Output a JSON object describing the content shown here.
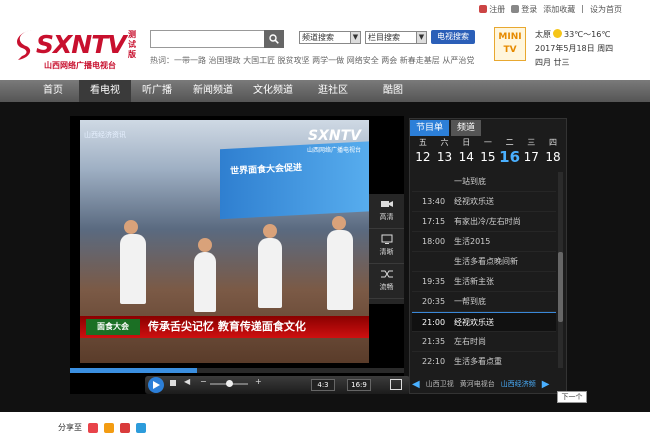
{
  "toplinks": {
    "register": "注册",
    "login": "登录",
    "favorite": "添加收藏",
    "homepage": "设为首页"
  },
  "logo": {
    "name": "SXNTV",
    "sub": "山西网络广播电视台",
    "beta": "测试版"
  },
  "search": {
    "placeholder": "",
    "hot_label": "热词：",
    "hot": "一带一路  治国理政  大国工匠  脱贫攻坚  两学一做  网络安全  两会  新春走基层  从严治党"
  },
  "selects": {
    "channel": "频道搜索",
    "column": "栏目搜索",
    "tv_search": "电视搜索"
  },
  "minitv": {
    "line1": "MINI",
    "line2": "TV"
  },
  "weather": {
    "city": "太原",
    "temp": "33℃～16℃",
    "date": "2017年5月18日",
    "weekday": "周四",
    "lunar": "四月 廿三"
  },
  "nav": [
    "首页",
    "看电视",
    "听广播",
    "新闻频道",
    "文化频道",
    "逛社区",
    "酷图"
  ],
  "nav_active": 1,
  "video": {
    "corner": "山西经济资讯",
    "logo": "SXNTV",
    "logo_sub": "山西网络广播电视台",
    "banner": "世界面食大会促进",
    "badge": "面食大会",
    "caption": "传承舌尖记忆  教育传递面食文化"
  },
  "side": [
    {
      "label": "高清",
      "icon": "camera-icon"
    },
    {
      "label": "清晰",
      "icon": "screen-icon"
    },
    {
      "label": "流畅",
      "icon": "shuffle-icon"
    }
  ],
  "controls": {
    "ratio_a": "4:3",
    "ratio_b": "16:9",
    "progress": 0.38,
    "volume": 0.5
  },
  "epg": {
    "tabs": [
      "节目单",
      "频道"
    ],
    "days": [
      {
        "w": "五",
        "d": "12"
      },
      {
        "w": "六",
        "d": "13"
      },
      {
        "w": "日",
        "d": "14"
      },
      {
        "w": "一",
        "d": "15"
      },
      {
        "w": "二",
        "d": "16"
      },
      {
        "w": "三",
        "d": "17"
      },
      {
        "w": "四",
        "d": "18"
      }
    ],
    "day_active": 4,
    "programs": [
      {
        "t": "",
        "n": "一站到底"
      },
      {
        "t": "13:40",
        "n": "经视欢乐送"
      },
      {
        "t": "17:15",
        "n": "有家出冷/左右时尚"
      },
      {
        "t": "18:00",
        "n": "生活2015"
      },
      {
        "t": "",
        "n": "生活多看点晚间新"
      },
      {
        "t": "19:35",
        "n": "生活新主张"
      },
      {
        "t": "20:35",
        "n": "一帮到底"
      },
      {
        "t": "21:00",
        "n": "经视欢乐送"
      },
      {
        "t": "21:35",
        "n": "左右时尚"
      },
      {
        "t": "22:10",
        "n": "生活多看点重"
      }
    ],
    "now_index": 7,
    "channels": [
      "山西卫视",
      "黄河电视台",
      "山西经济频"
    ],
    "channel_active": 2,
    "next": "下一个"
  },
  "share": {
    "label": "分享至"
  }
}
